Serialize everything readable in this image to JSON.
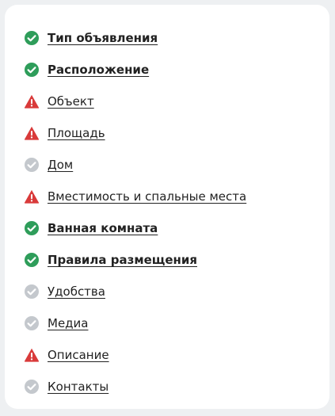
{
  "colors": {
    "done": "#2e9d5a",
    "warning": "#d93a3a",
    "pending": "#c4c8cd",
    "text": "#222222"
  },
  "steps": [
    {
      "label": "Тип объявления",
      "status": "done",
      "icon": "check-circle-icon"
    },
    {
      "label": "Расположение",
      "status": "done",
      "icon": "check-circle-icon"
    },
    {
      "label": "Объект",
      "status": "warning",
      "icon": "warning-triangle-icon"
    },
    {
      "label": "Площадь",
      "status": "warning",
      "icon": "warning-triangle-icon"
    },
    {
      "label": "Дом",
      "status": "pending",
      "icon": "check-circle-icon"
    },
    {
      "label": "Вместимость и спальные места",
      "status": "warning",
      "icon": "warning-triangle-icon"
    },
    {
      "label": "Ванная комната",
      "status": "done",
      "icon": "check-circle-icon"
    },
    {
      "label": "Правила размещения",
      "status": "done",
      "icon": "check-circle-icon"
    },
    {
      "label": "Удобства",
      "status": "pending",
      "icon": "check-circle-icon"
    },
    {
      "label": "Медиа",
      "status": "pending",
      "icon": "check-circle-icon"
    },
    {
      "label": "Описание",
      "status": "warning",
      "icon": "warning-triangle-icon"
    },
    {
      "label": "Контакты",
      "status": "pending",
      "icon": "check-circle-icon"
    }
  ]
}
